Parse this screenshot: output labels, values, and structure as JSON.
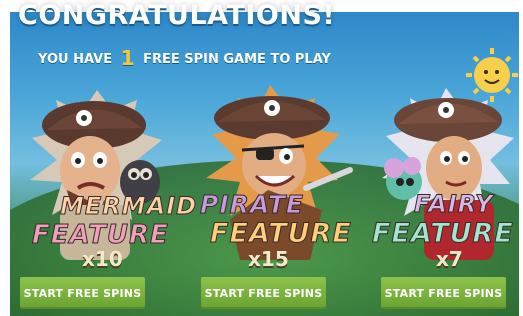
{
  "header": {
    "title": "CONGRATULATIONS!",
    "subtitle_before": "YOU HAVE",
    "subtitle_count": "1",
    "subtitle_after": "FREE SPIN GAME TO PLAY"
  },
  "features": [
    {
      "word1": "MERMAID",
      "word2": "FEATURE",
      "multiplier": "x10",
      "button": "START FREE SPINS"
    },
    {
      "word1": "PIRATE",
      "word2": "FEATURE",
      "multiplier": "x15",
      "button": "START FREE SPINS"
    },
    {
      "word1": "FAIRY",
      "word2": "FEATURE",
      "multiplier": "x7",
      "button": "START FREE SPINS"
    }
  ],
  "colors": {
    "sky": "#2d87c9",
    "grass": "#2f6e34",
    "button": "#7cb342",
    "headline": "#ffffff",
    "highlight": "#f6c63a"
  }
}
